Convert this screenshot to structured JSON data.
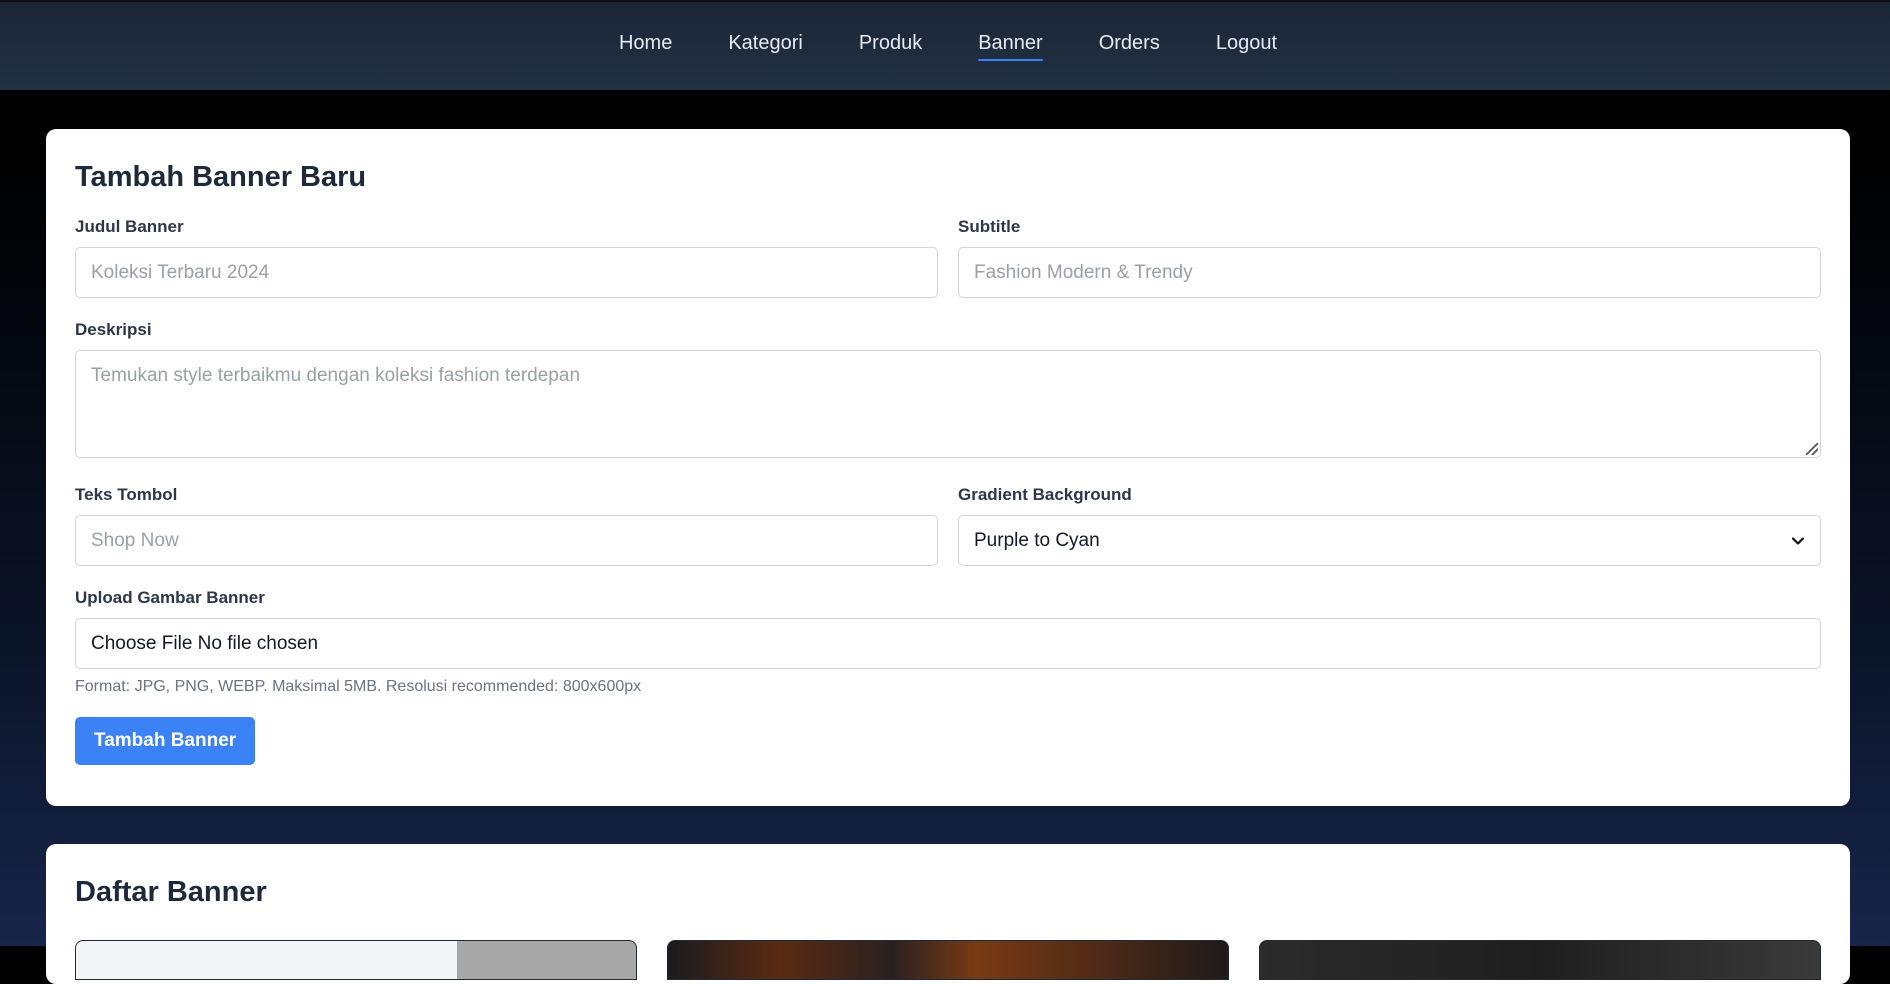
{
  "nav": {
    "items": [
      {
        "label": "Home"
      },
      {
        "label": "Kategori"
      },
      {
        "label": "Produk"
      },
      {
        "label": "Banner"
      },
      {
        "label": "Orders"
      },
      {
        "label": "Logout"
      }
    ],
    "active": "Banner"
  },
  "form": {
    "title": "Tambah Banner Baru",
    "judul": {
      "label": "Judul Banner",
      "placeholder": "Koleksi Terbaru 2024"
    },
    "subtitle": {
      "label": "Subtitle",
      "placeholder": "Fashion Modern & Trendy"
    },
    "deskripsi": {
      "label": "Deskripsi",
      "placeholder": "Temukan style terbaikmu dengan koleksi fashion terdepan"
    },
    "teks_tombol": {
      "label": "Teks Tombol",
      "placeholder": "Shop Now"
    },
    "gradient": {
      "label": "Gradient Background",
      "selected": "Purple to Cyan"
    },
    "upload": {
      "label": "Upload Gambar Banner",
      "value": "Choose File No file chosen",
      "hint": "Format: JPG, PNG, WEBP. Maksimal 5MB. Resolusi recommended: 800x600px"
    },
    "submit_label": "Tambah Banner"
  },
  "list": {
    "title": "Daftar Banner"
  },
  "colors": {
    "accent": "#3b82f6",
    "nav_bg": "#1f2b3d",
    "card_bg": "#ffffff"
  }
}
